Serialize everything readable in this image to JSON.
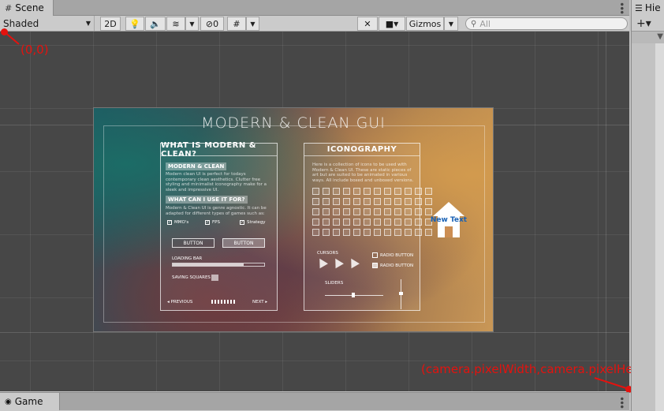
{
  "scene_tab": {
    "label": "Scene",
    "icon": "grid-icon"
  },
  "toolbar": {
    "draw_mode": "Shaded",
    "mode_2d": "2D",
    "hidden_count": "0",
    "gizmos": "Gizmos",
    "search_placeholder": "All"
  },
  "canvas": {
    "title": "MODERN & CLEAN GUI",
    "left_panel": {
      "header": "WHAT IS MODERN & CLEAN?",
      "section1": "MODERN & CLEAN",
      "text1": "Modern clean UI is perfect for todays contemporary clean aesthetics. Clutter free styling and minimalist iconography make for a sleek and impressive UI.",
      "section2": "WHAT CAN I USE IT FOR?",
      "text2": "Modern & Clean UI is genre agnostic. It can be adapted for different types of games such as:",
      "checks": [
        "MMO's",
        "FPS",
        "Strategy"
      ],
      "button_a": "BUTTON",
      "button_b": "BUTTON",
      "loading_label": "LOADING BAR",
      "loading_value": 0.78,
      "saving_label": "SAVING SQUARES",
      "prev": "◂ PREVIOUS",
      "next": "NEXT ▸"
    },
    "right_panel": {
      "header": "ICONOGRAPHY",
      "text": "Here is a collection of icons to be used with Modern & Clean UI. These are static pieces of art but are suited to be animated in various ways. All include boxed and unboxed versions.",
      "cursors_label": "CURSORS",
      "radio_a": "RADIO BUTTON",
      "radio_b": "RADIO BUTTON",
      "sliders_label": "SLIDERS"
    },
    "new_text": "New Text"
  },
  "annotations": {
    "origin": "(0,0)",
    "extent": "(camera.pixelWidth,camera.pixelHeight)"
  },
  "hierarchy_tab": {
    "label": "Hie",
    "add": "+▾"
  },
  "game_tab": {
    "label": "Game",
    "icon": "gamepad-icon"
  },
  "colors": {
    "annotation": "#e4120e",
    "new_text": "#1a62b5",
    "viewport": "#474747"
  }
}
